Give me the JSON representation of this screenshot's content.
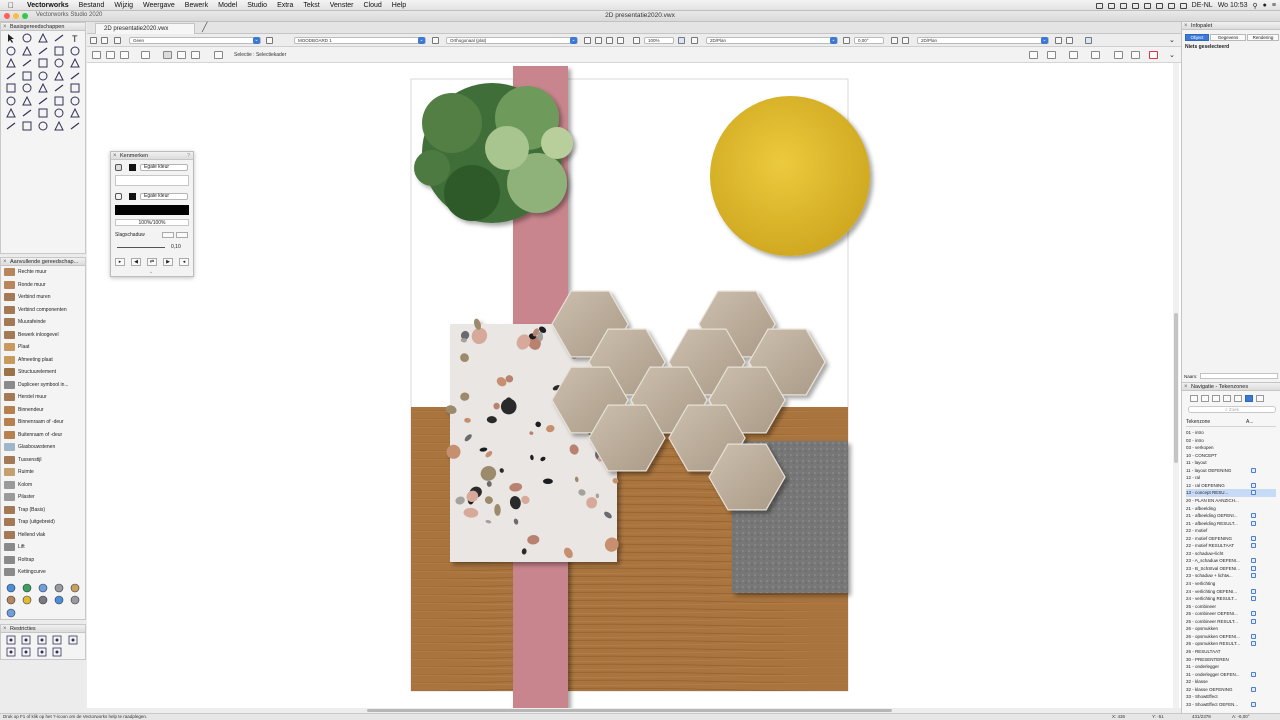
{
  "menubar": {
    "app": "Vectorworks",
    "items": [
      "Bestand",
      "Wijzig",
      "Weergave",
      "Bewerk",
      "Model",
      "Studio",
      "Extra",
      "Tekst",
      "Venster",
      "Cloud",
      "Help"
    ],
    "clock": "Wo 10:53",
    "locale": "DE-NL"
  },
  "window": {
    "app_title": "Vectorworks Studio 2020",
    "doc_title": "2D presentatie2020.vwx",
    "tab_label": "2D presentatie2020.vwx"
  },
  "palettes": {
    "basis_title": "Basisgereedschappen",
    "aanvullend_title": "Aanvullende gereedschap...",
    "aanvullend_items": [
      {
        "label": "Rechte muur",
        "color": "#b8865a"
      },
      {
        "label": "Ronde muur",
        "color": "#b8865a"
      },
      {
        "label": "Verbind muren",
        "color": "#a37a55"
      },
      {
        "label": "Verbind componenten",
        "color": "#a37a55"
      },
      {
        "label": "Muurafeinde",
        "color": "#a37a55"
      },
      {
        "label": "Bewerk inloogevel",
        "color": "#a37a55"
      },
      {
        "label": "Plaat",
        "color": "#c99a5e"
      },
      {
        "label": "Afmeeting plaat",
        "color": "#c99a5e"
      },
      {
        "label": "Structuurelement",
        "color": "#9a7448"
      },
      {
        "label": "Dupliceer symbool in...",
        "color": "#8a8a8a"
      },
      {
        "label": "Herstel muur",
        "color": "#a37a55"
      },
      {
        "label": "Binnendeur",
        "color": "#b6804f"
      },
      {
        "label": "Binnenraam of -deur",
        "color": "#b6804f"
      },
      {
        "label": "Buitenraam of -deur",
        "color": "#b6804f"
      },
      {
        "label": "Glasbouwstenen",
        "color": "#9fb6c9"
      },
      {
        "label": "Tussenstijl",
        "color": "#a37a55"
      },
      {
        "label": "Ruimte",
        "color": "#c3a06d"
      },
      {
        "label": "Kolom",
        "color": "#9a9a9a"
      },
      {
        "label": "Pilaster",
        "color": "#9a9a9a"
      },
      {
        "label": "Trap (Basis)",
        "color": "#a37a55"
      },
      {
        "label": "Trap (uitgebreid)",
        "color": "#a37a55"
      },
      {
        "label": "Hellend vlak",
        "color": "#a37a55"
      },
      {
        "label": "Lift",
        "color": "#8a8a8a"
      },
      {
        "label": "Roltrap",
        "color": "#8a8a8a"
      },
      {
        "label": "Kettingcurve",
        "color": "#8a8a8a"
      }
    ],
    "restricties_title": "Restricties"
  },
  "viewbar": {
    "class": "Geen",
    "layer": "MOODBOARD 1",
    "projection": "Orthogonaal (plat)",
    "zoom": "100%",
    "view": "2D/Plan",
    "angle": "0,00°",
    "render": "2D/Plan"
  },
  "modebar": {
    "mode_label": "Selectie : Selectiekader"
  },
  "kenmerken": {
    "title": "Kenmerken",
    "fill_label": "Egale kleur",
    "pen_label": "Egale kleur",
    "opacity": "100%/100%",
    "shadow_label": "Slagschaduw",
    "line_weight": "0,10"
  },
  "infopalet": {
    "title": "Infopalet",
    "tabs": [
      "Object",
      "Gegevens",
      "Rendering"
    ],
    "status": "Niets geselecteerd",
    "naam_label": "Naam:"
  },
  "navigation": {
    "title": "Navigatie - Tekenzones",
    "search_placeholder": "Zoek",
    "column_header": "Tekenzone",
    "column_header2": "A...",
    "items": [
      {
        "label": "01 - intro",
        "doc": false,
        "selected": false
      },
      {
        "label": "02 - intro",
        "doc": false,
        "selected": false
      },
      {
        "label": "03 - verkopen",
        "doc": false,
        "selected": false
      },
      {
        "label": "10 - CONCEPT",
        "doc": false,
        "selected": false
      },
      {
        "label": "11 - layout",
        "doc": false,
        "selected": false
      },
      {
        "label": "11 - layout OEFENING",
        "doc": true,
        "selected": false
      },
      {
        "label": "12 - ral",
        "doc": false,
        "selected": false
      },
      {
        "label": "12 - ral OEFENING",
        "doc": true,
        "selected": false
      },
      {
        "label": "13 - concept RESU...",
        "doc": true,
        "selected": true
      },
      {
        "label": "20 - PLAN EN AANZICH...",
        "doc": false,
        "selected": false
      },
      {
        "label": "21 - afbeelding",
        "doc": false,
        "selected": false
      },
      {
        "label": "21 - afbeelding OEFENI...",
        "doc": true,
        "selected": false
      },
      {
        "label": "21 - afbeelding RESULT...",
        "doc": true,
        "selected": false
      },
      {
        "label": "22 - motief",
        "doc": false,
        "selected": false
      },
      {
        "label": "22 - motief OEFENING",
        "doc": true,
        "selected": false
      },
      {
        "label": "22 - motief RESULTAAT",
        "doc": true,
        "selected": false
      },
      {
        "label": "23 - schaduw+licht",
        "doc": false,
        "selected": false
      },
      {
        "label": "23 - A_schaduw OEFENI...",
        "doc": true,
        "selected": false
      },
      {
        "label": "23 - B_SchStval OEFENI...",
        "doc": true,
        "selected": false
      },
      {
        "label": "23 - schaduw + lichtw...",
        "doc": true,
        "selected": false
      },
      {
        "label": "24 - verlichting",
        "doc": false,
        "selected": false
      },
      {
        "label": "24 - verlichting OEFENI...",
        "doc": true,
        "selected": false
      },
      {
        "label": "24 - verlichting RESULT...",
        "doc": true,
        "selected": false
      },
      {
        "label": "25 - combineer",
        "doc": false,
        "selected": false
      },
      {
        "label": "25 - combineer OEFENI...",
        "doc": true,
        "selected": false
      },
      {
        "label": "25 - combineer RESULT...",
        "doc": true,
        "selected": false
      },
      {
        "label": "26 - opsmukken",
        "doc": false,
        "selected": false
      },
      {
        "label": "26 - opsmukken OEFENI...",
        "doc": true,
        "selected": false
      },
      {
        "label": "26 - opsmukken RESULT...",
        "doc": true,
        "selected": false
      },
      {
        "label": "26 - RESULTAAT",
        "doc": false,
        "selected": false
      },
      {
        "label": "30 - PRESENTEREN",
        "doc": false,
        "selected": false
      },
      {
        "label": "31 - onderlegger",
        "doc": false,
        "selected": false
      },
      {
        "label": "31 - onderlegger OEFEN...",
        "doc": true,
        "selected": false
      },
      {
        "label": "32 - klasse",
        "doc": false,
        "selected": false
      },
      {
        "label": "32 - klasse OEFENING",
        "doc": true,
        "selected": false
      },
      {
        "label": "33 - ShowEffect",
        "doc": false,
        "selected": false
      },
      {
        "label": "33 - ShowEffect OEFEN...",
        "doc": true,
        "selected": false
      }
    ]
  },
  "statusbar": {
    "help_text": "Druk op F1 of klik op het ?-icoon om de Vectorworks help te raadplegen.",
    "x_label": "X: 436",
    "y_label": "Y: -51",
    "coords": "431/2378",
    "angle": "A: -6,00°"
  },
  "colors": {
    "accent": "#3a79d6",
    "pink_strip": "#c8858d",
    "wood": "#a8743f",
    "mustard": "#e0bc2e",
    "leather": "#7a7a7a"
  }
}
